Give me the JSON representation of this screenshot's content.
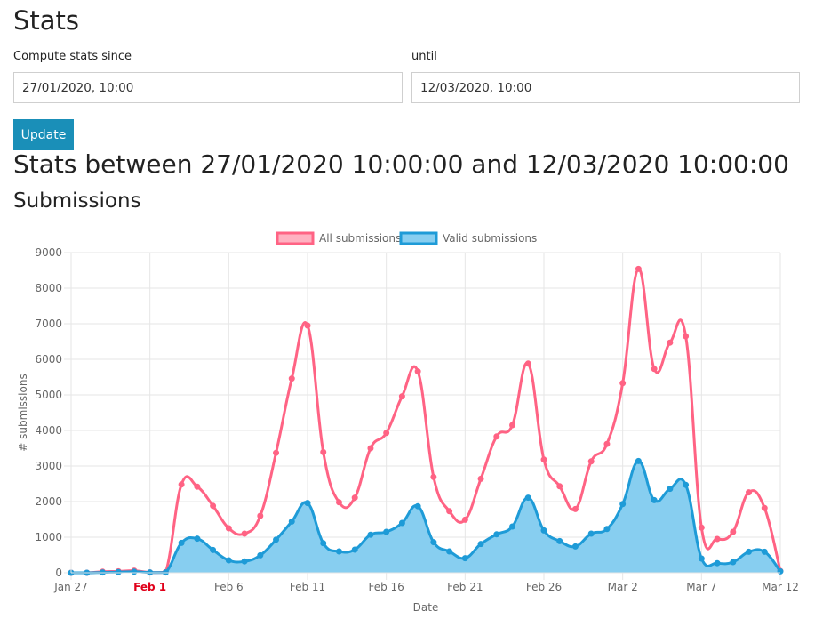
{
  "page": {
    "title": "Stats",
    "since_label": "Compute stats since",
    "until_label": "until",
    "since_value": "27/01/2020, 10:00",
    "until_value": "12/03/2020, 10:00",
    "update_label": "Update",
    "range_heading": "Stats between 27/01/2020 10:00:00 and 12/03/2020 10:00:00",
    "section_heading": "Submissions"
  },
  "colors": {
    "all_line": "#ff6384",
    "all_fill": "#ffb1c1",
    "valid_line": "#1e9bd7",
    "valid_fill": "#87cef0",
    "button": "#1a8fb8"
  },
  "chart_data": {
    "type": "line",
    "xlabel": "Date",
    "ylabel": "# submissions",
    "ylim": [
      0,
      9000
    ],
    "yticks": [
      0,
      1000,
      2000,
      3000,
      4000,
      5000,
      6000,
      7000,
      8000,
      9000
    ],
    "xlim": [
      "2020-01-27",
      "2020-03-12"
    ],
    "x_ticks": [
      {
        "date": "2020-01-27",
        "label": "Jan 27",
        "major": false
      },
      {
        "date": "2020-02-01",
        "label": "Feb 1",
        "major": true
      },
      {
        "date": "2020-02-06",
        "label": "Feb 6",
        "major": false
      },
      {
        "date": "2020-02-11",
        "label": "Feb 11",
        "major": false
      },
      {
        "date": "2020-02-16",
        "label": "Feb 16",
        "major": false
      },
      {
        "date": "2020-02-21",
        "label": "Feb 21",
        "major": false
      },
      {
        "date": "2020-02-26",
        "label": "Feb 26",
        "major": false
      },
      {
        "date": "2020-03-02",
        "label": "Mar 2",
        "major": false
      },
      {
        "date": "2020-03-07",
        "label": "Mar 7",
        "major": false
      },
      {
        "date": "2020-03-12",
        "label": "Mar 12",
        "major": false
      }
    ],
    "grid": true,
    "legend_position": "top",
    "x": [
      "2020-01-27",
      "2020-01-28",
      "2020-01-29",
      "2020-01-30",
      "2020-01-31",
      "2020-02-01",
      "2020-02-02",
      "2020-02-03",
      "2020-02-04",
      "2020-02-05",
      "2020-02-06",
      "2020-02-07",
      "2020-02-08",
      "2020-02-09",
      "2020-02-10",
      "2020-02-11",
      "2020-02-12",
      "2020-02-13",
      "2020-02-14",
      "2020-02-15",
      "2020-02-16",
      "2020-02-17",
      "2020-02-18",
      "2020-02-19",
      "2020-02-20",
      "2020-02-21",
      "2020-02-22",
      "2020-02-23",
      "2020-02-24",
      "2020-02-25",
      "2020-02-26",
      "2020-02-27",
      "2020-02-28",
      "2020-02-29",
      "2020-03-01",
      "2020-03-02",
      "2020-03-03",
      "2020-03-04",
      "2020-03-05",
      "2020-03-06",
      "2020-03-07",
      "2020-03-08",
      "2020-03-09",
      "2020-03-10",
      "2020-03-11",
      "2020-03-12"
    ],
    "series": [
      {
        "name": "All submissions",
        "values": [
          0,
          0,
          30,
          40,
          60,
          10,
          20,
          2480,
          2420,
          1880,
          1250,
          1100,
          1600,
          3370,
          5460,
          6950,
          3390,
          1980,
          2110,
          3500,
          3930,
          4960,
          5660,
          2690,
          1730,
          1490,
          2640,
          3830,
          4150,
          5880,
          3180,
          2430,
          1790,
          3130,
          3620,
          5330,
          8540,
          5730,
          6470,
          6650,
          1270,
          950,
          1150,
          2260,
          1820,
          50
        ]
      },
      {
        "name": "Valid submissions",
        "values": [
          0,
          0,
          10,
          20,
          30,
          10,
          10,
          840,
          960,
          640,
          350,
          320,
          490,
          930,
          1440,
          1960,
          830,
          600,
          650,
          1070,
          1150,
          1400,
          1870,
          860,
          600,
          410,
          810,
          1080,
          1300,
          2110,
          1190,
          890,
          740,
          1100,
          1230,
          1930,
          3140,
          2040,
          2360,
          2470,
          400,
          270,
          300,
          590,
          590,
          40
        ]
      }
    ]
  }
}
